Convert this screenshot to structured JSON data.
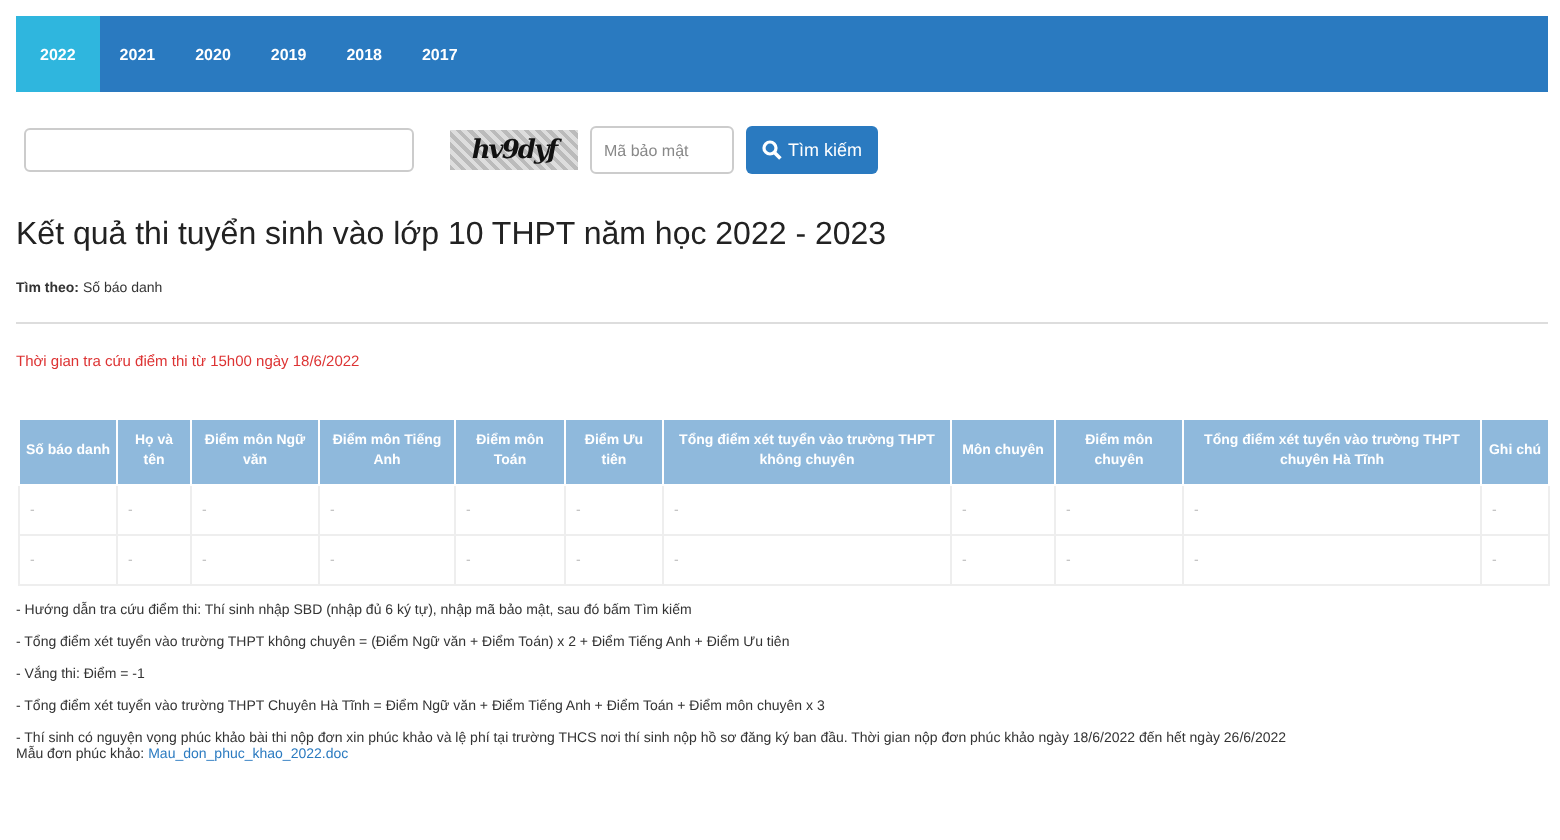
{
  "tabs": [
    {
      "label": "2022",
      "selected": true
    },
    {
      "label": "2021",
      "selected": false
    },
    {
      "label": "2020",
      "selected": false
    },
    {
      "label": "2019",
      "selected": false
    },
    {
      "label": "2018",
      "selected": false
    },
    {
      "label": "2017",
      "selected": false
    }
  ],
  "search": {
    "captcha": "hv9dyf",
    "captcha_placeholder": "Mã bảo mật",
    "button": "Tìm kiếm"
  },
  "title": "Kết quả thi tuyển sinh vào lớp 10 THPT năm học 2022 - 2023",
  "search_by": {
    "label": "Tìm theo:",
    "value": "Số báo danh"
  },
  "notice": "Thời gian tra cứu điểm thi từ 15h00 ngày 18/6/2022",
  "table": {
    "columns": [
      "Số báo danh",
      "Họ và tên",
      "Điểm môn Ngữ văn",
      "Điểm môn Tiếng Anh",
      "Điểm môn Toán",
      "Điểm Ưu tiên",
      "Tổng điểm xét tuyển vào trường THPT không chuyên",
      "Môn chuyên",
      "Điểm môn chuyên",
      "Tổng điểm xét tuyển vào trường THPT chuyên Hà Tĩnh",
      "Ghi chú"
    ],
    "rows": [
      [
        "-",
        "-",
        "-",
        "-",
        "-",
        "-",
        "-",
        "-",
        "-",
        "-",
        "-"
      ],
      [
        "-",
        "-",
        "-",
        "-",
        "-",
        "-",
        "-",
        "-",
        "-",
        "-",
        "-"
      ]
    ]
  },
  "notes": [
    "- Hướng dẫn tra cứu điểm thi: Thí sinh nhập SBD (nhập đủ 6 ký tự), nhập mã bảo mật, sau đó bấm Tìm kiếm",
    "- Tổng điểm xét tuyển vào trường THPT không chuyên = (Điểm Ngữ văn + Điểm Toán) x  2 + Điểm Tiếng Anh + Điểm Ưu tiên",
    "- Vắng thi: Điểm = -1",
    "- Tổng điểm xét tuyển vào trường THPT Chuyên Hà Tĩnh = Điểm Ngữ văn + Điểm Tiếng Anh + Điểm Toán + Điểm môn chuyên x 3",
    "- Thí sinh có nguyện vọng phúc khảo bài thi nộp đơn xin phúc khảo và lệ phí tại trường THCS nơi thí sinh nộp hồ  sơ đăng ký ban đầu. Thời gian nộp đơn phúc khảo ngày 18/6/2022 đến hết ngày 26/6/2022"
  ],
  "form_link": {
    "label": "Mẫu đơn phúc khảo:",
    "link": "Mau_don_phuc_khao_2022.doc"
  }
}
